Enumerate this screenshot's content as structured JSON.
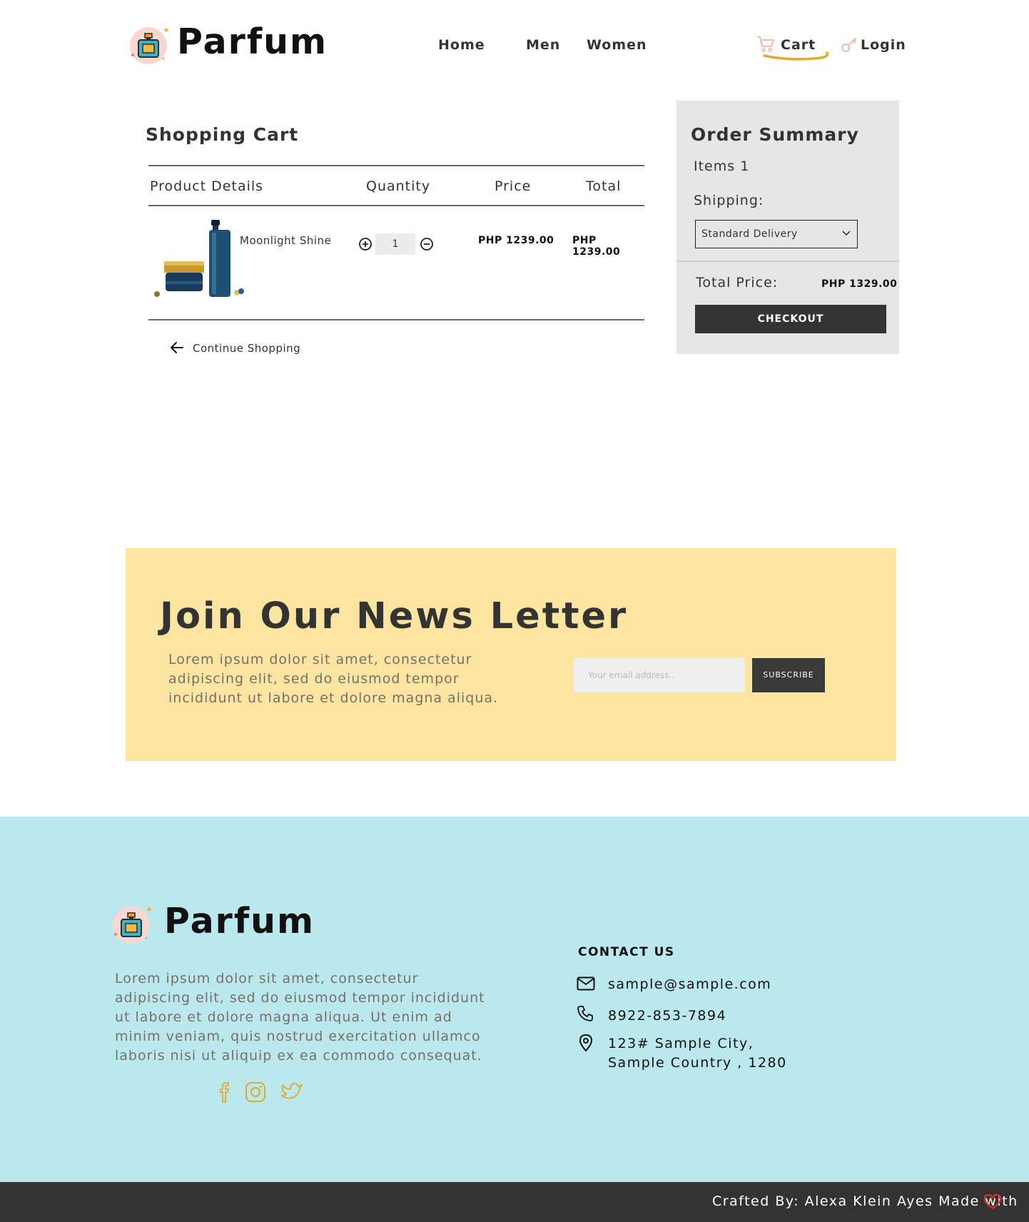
{
  "header": {
    "brand": "Parfum",
    "nav": {
      "home": "Home",
      "men": "Men",
      "women": "Women",
      "cart": "Cart",
      "login": "Login"
    }
  },
  "cart": {
    "title": "Shopping Cart",
    "columns": [
      "Product Details",
      "Quantity",
      "Price",
      "Total"
    ],
    "items": [
      {
        "name": "Moonlight Shine",
        "quantity": "1",
        "price": "PHP 1239.00",
        "total": "PHP 1239.00"
      }
    ],
    "continue_label": "Continue Shopping"
  },
  "summary": {
    "title": "Order Summary",
    "items_label": "Items 1",
    "shipping_label": "Shipping:",
    "shipping_value": "Standard Delivery",
    "total_label": "Total Price:",
    "total_value": "PHP 1329.00",
    "checkout_label": "CHECKOUT"
  },
  "newsletter": {
    "title": "Join Our News Letter",
    "text": "Lorem ipsum dolor sit amet, consectetur adipiscing elit, sed do eiusmod tempor incididunt ut labore et dolore magna aliqua.",
    "email_placeholder": "Your email address..",
    "subscribe_label": "SUBSCRIBE"
  },
  "footer": {
    "brand": "Parfum",
    "text": "Lorem ipsum dolor sit amet, consectetur adipiscing elit, sed do eiusmod tempor incididunt ut labore et dolore magna aliqua. Ut enim ad minim veniam, quis nostrud exercitation ullamco laboris nisi ut aliquip ex ea commodo consequat.",
    "contact_heading": "CONTACT US",
    "email": "sample@sample.com",
    "phone": "8922-853-7894",
    "address_line1": "123# Sample City,",
    "address_line2": "Sample Country , 1280",
    "crafted": "Crafted By: Alexa Klein Ayes Made with"
  },
  "colors": {
    "accent": "#e3a92a",
    "newsletter_bg": "#fce4a1",
    "footer_bg": "#bae8ed",
    "dark": "#333333",
    "heart": "#e52b2b"
  },
  "icons": [
    "perfume-logo-icon",
    "cart-icon",
    "key-icon",
    "plus-circle-icon",
    "minus-circle-icon",
    "chevron-down-icon",
    "arrow-left-icon",
    "mail-icon",
    "phone-icon",
    "location-pin-icon",
    "facebook-icon",
    "instagram-icon",
    "twitter-icon",
    "heart-icon"
  ]
}
